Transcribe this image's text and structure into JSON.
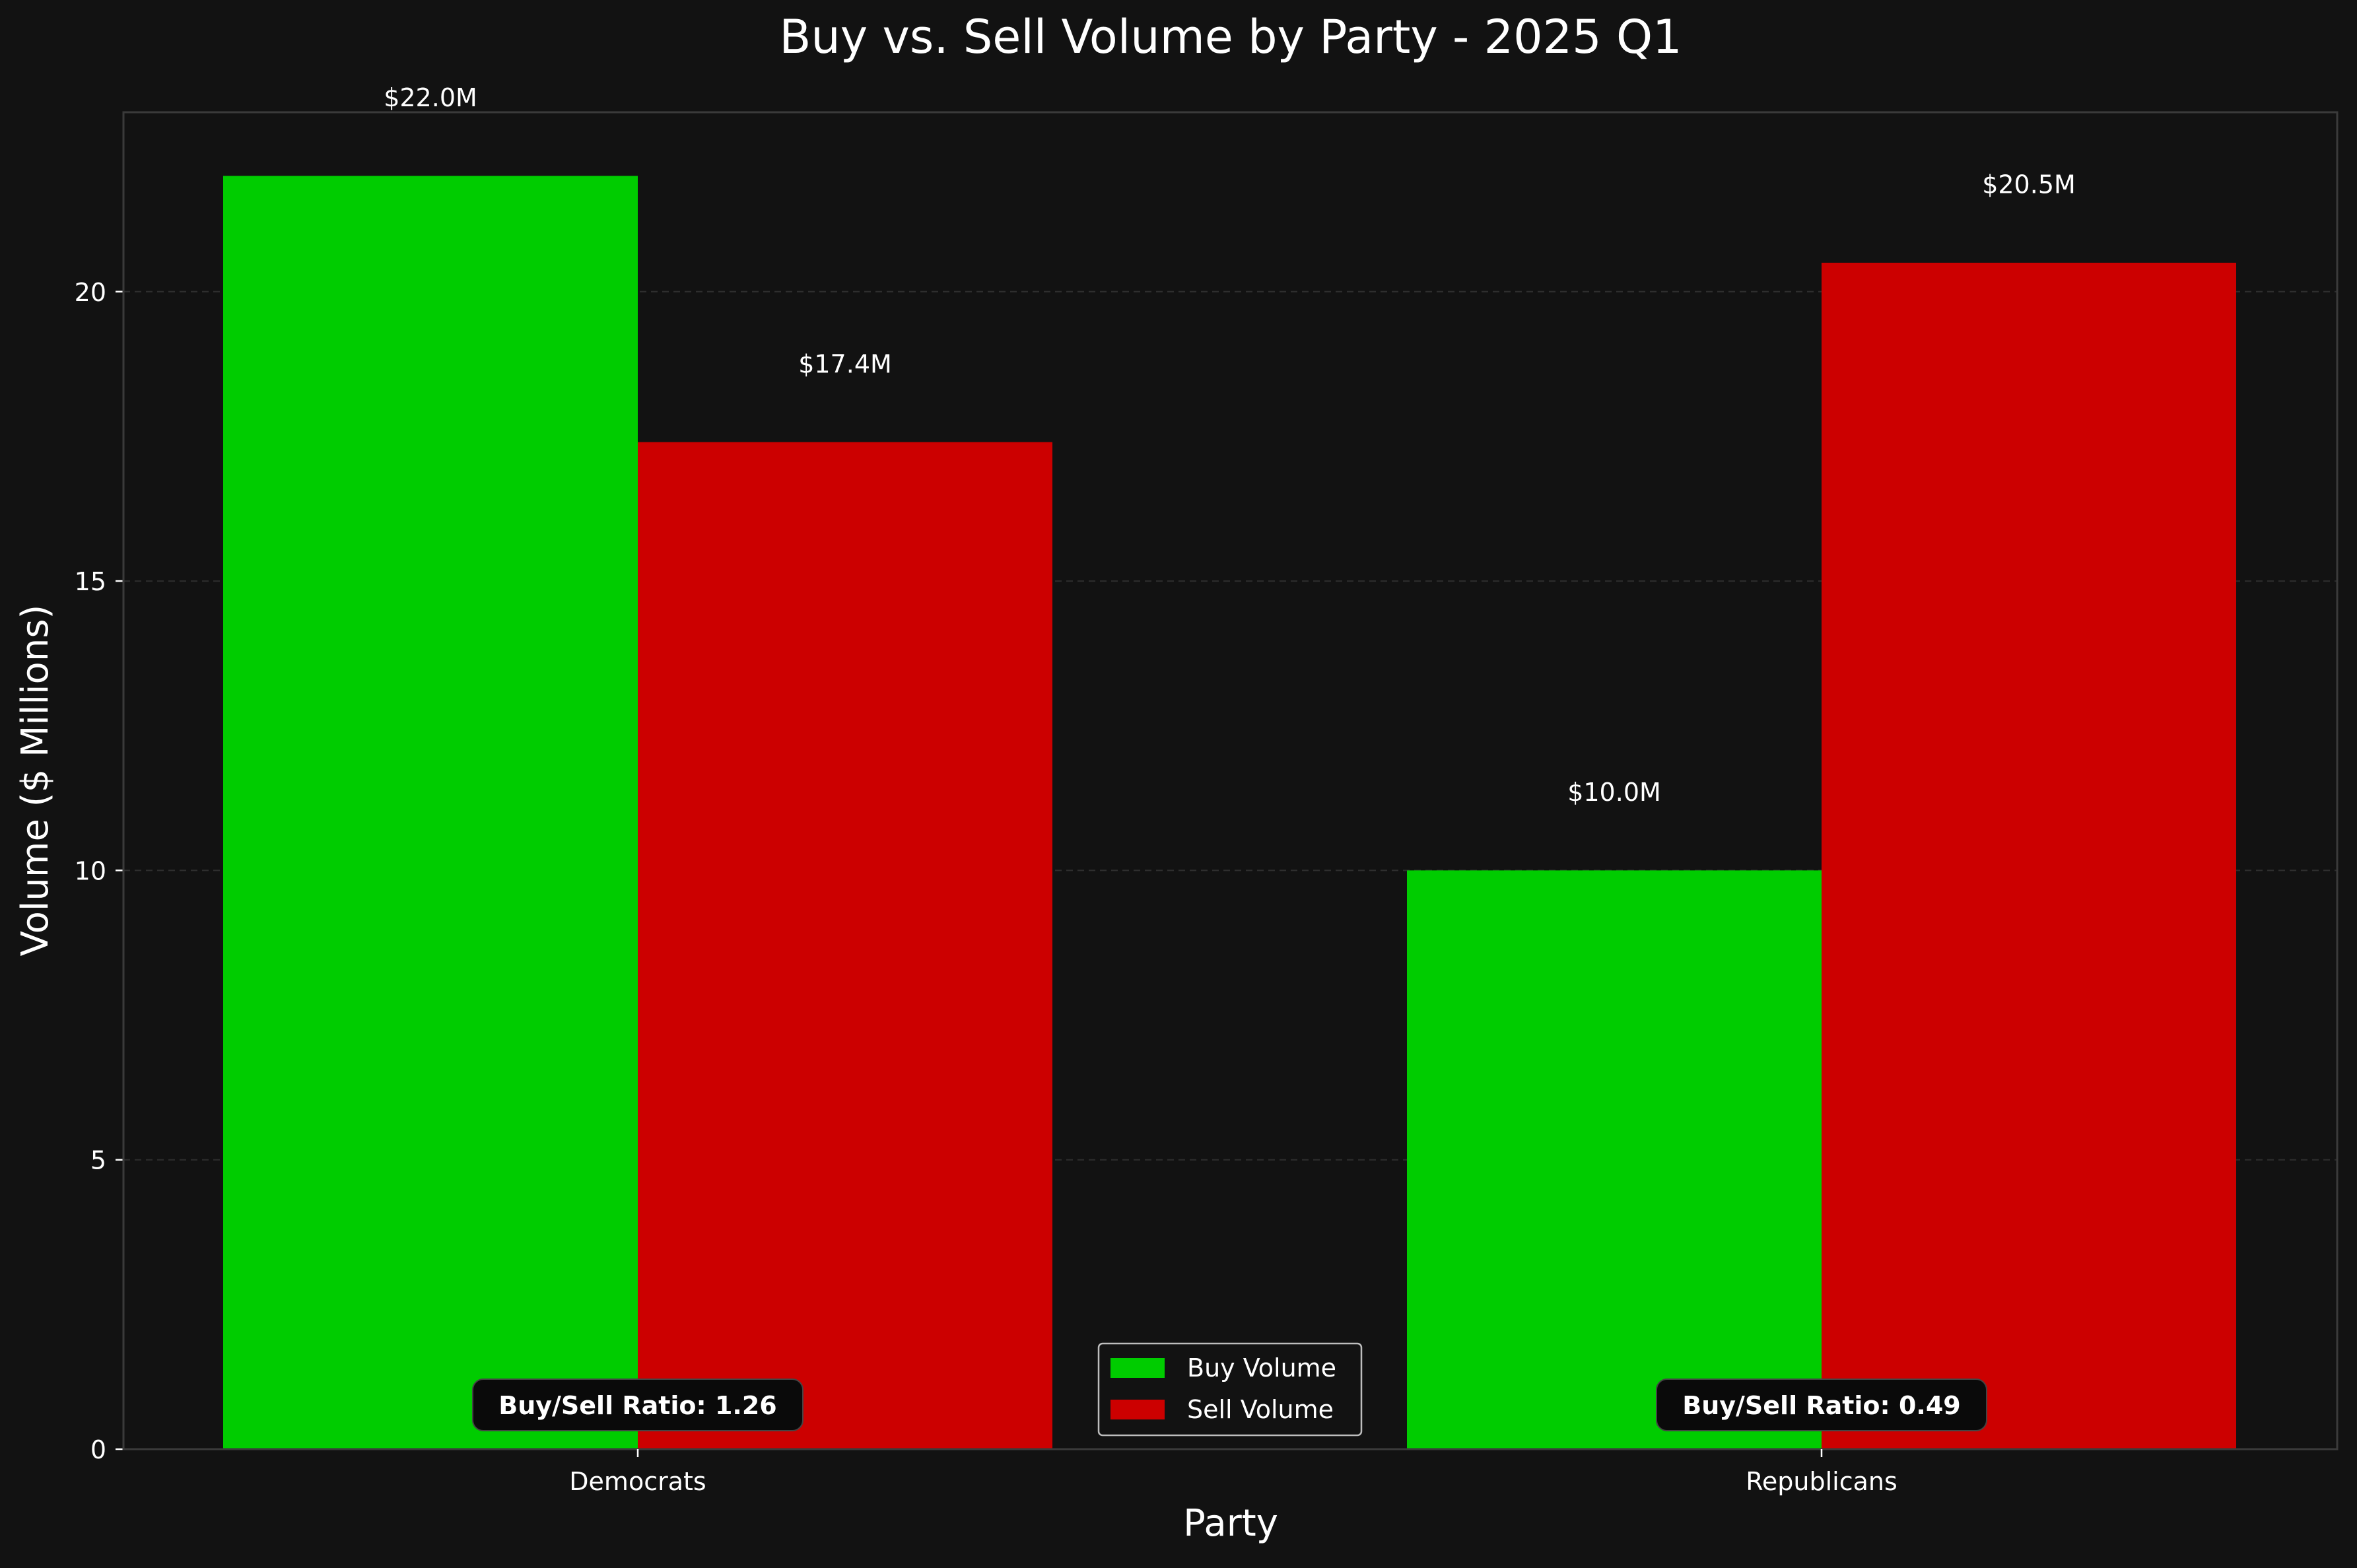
{
  "chart_data": {
    "type": "bar",
    "title": "Buy vs. Sell Volume by Party - 2025 Q1",
    "xlabel": "Party",
    "ylabel": "Volume ($ Millions)",
    "categories": [
      "Democrats",
      "Republicans"
    ],
    "series": [
      {
        "name": "Buy Volume",
        "color": "#00cc00",
        "values": [
          22.0,
          10.0
        ],
        "labels": [
          "$22.0M",
          "$10.0M"
        ]
      },
      {
        "name": "Sell Volume",
        "color": "#cc0000",
        "values": [
          17.4,
          20.5
        ],
        "labels": [
          "$17.4M",
          "$20.5M"
        ]
      }
    ],
    "annotations": [
      "Buy/Sell Ratio: 1.26",
      "Buy/Sell Ratio: 0.49"
    ],
    "ylim": [
      0,
      23.1
    ],
    "yticks": [
      0,
      5,
      10,
      15,
      20
    ],
    "grid": true,
    "legend_position": "bottom-center"
  },
  "colors": {
    "background": "#121212",
    "axes_background": "#121212",
    "text": "#ffffff",
    "axis_edge": "#3a3a3a",
    "grid": "#2e2e2e",
    "annotation_box": "#0a0a0a"
  }
}
